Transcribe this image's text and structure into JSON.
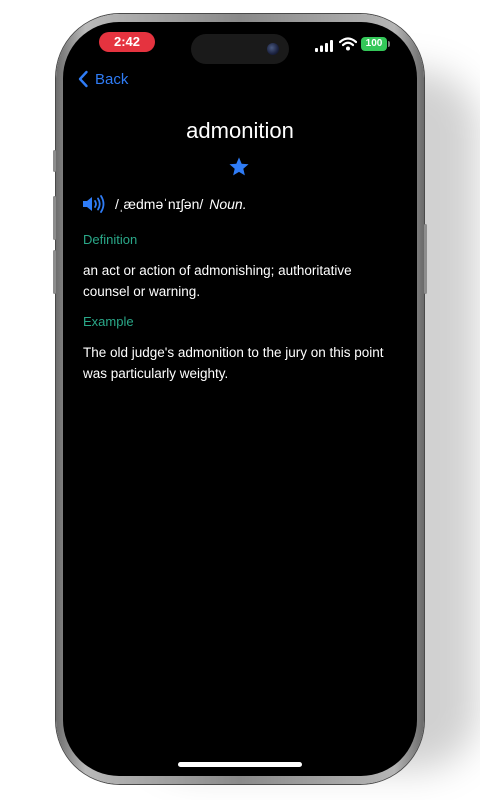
{
  "status_bar": {
    "time": "2:42",
    "battery": "100"
  },
  "nav": {
    "back_label": "Back"
  },
  "entry": {
    "word": "admonition",
    "pronunciation": "/ˌædməˈnɪʃən/",
    "part_of_speech": "Noun.",
    "definition_heading": "Definition",
    "definition": "an act or action of admonishing; authoritative counsel or warning.",
    "example_heading": "Example",
    "example": "The old judge's admonition to the jury on this point was particularly weighty."
  },
  "icons": {
    "back": "chevron-left-icon",
    "favorite": "star-icon",
    "audio": "speaker-icon"
  },
  "colors": {
    "accent": "#2f7cf6",
    "section": "#2aa889",
    "time_pill": "#e5333f",
    "battery": "#34c759"
  }
}
